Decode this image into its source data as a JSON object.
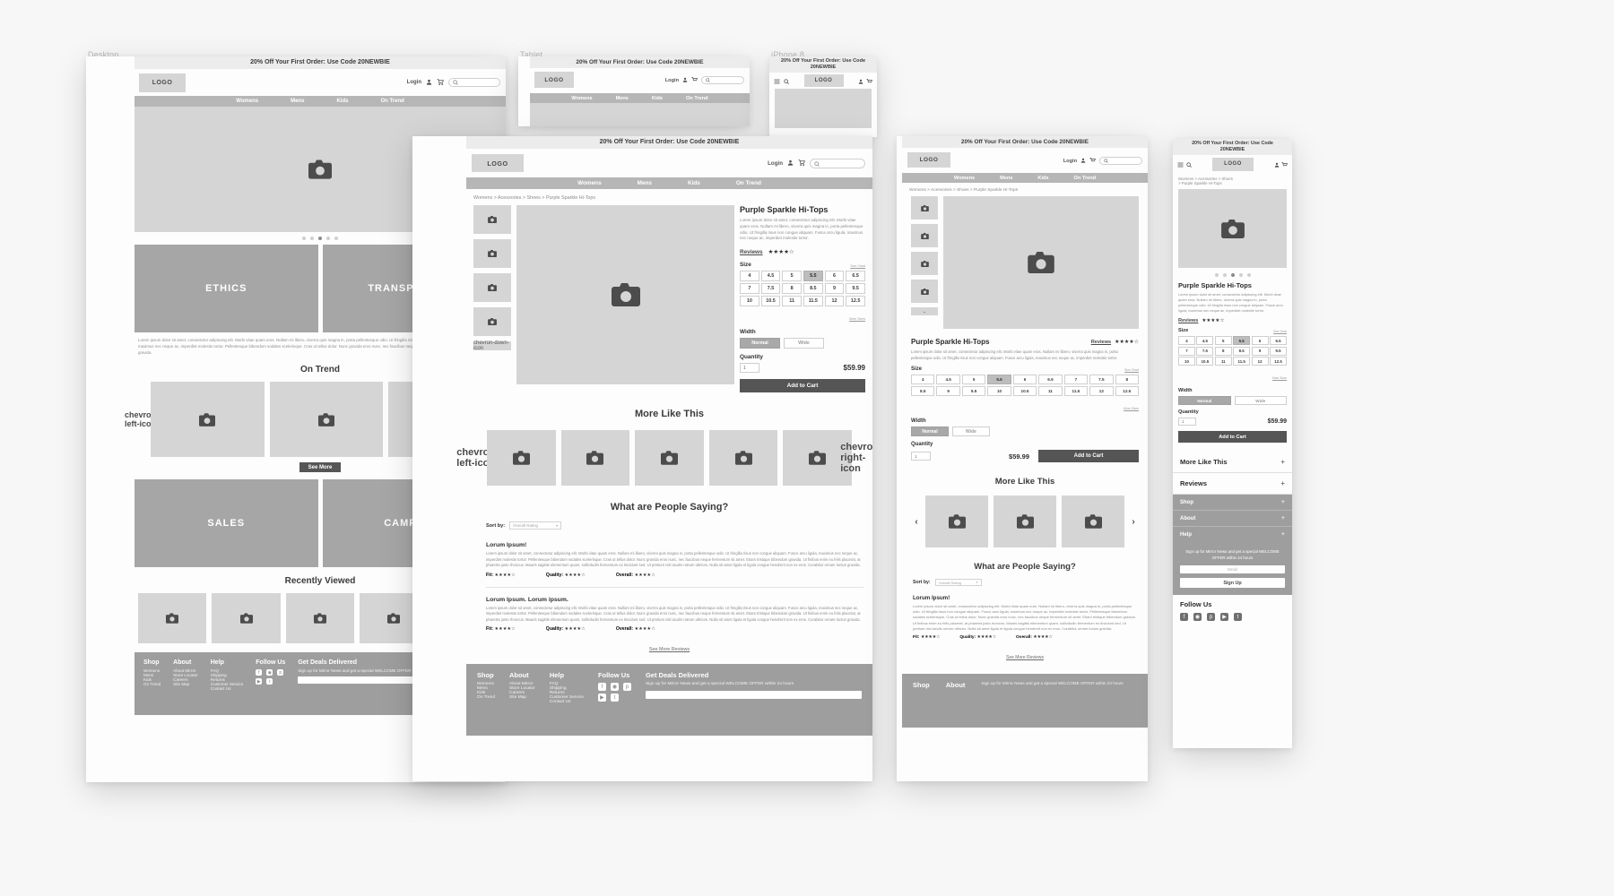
{
  "devices": {
    "desktop": "Desktop",
    "tablet": "Tablet",
    "iphone": "iPhone 8"
  },
  "promo": "20% Off Your First Order: Use Code 20NEWBIE",
  "logo": "LOGO",
  "nav": [
    "Womens",
    "Mens",
    "Kids",
    "On Trend"
  ],
  "util": {
    "login": "Login",
    "account_icon": "user-icon",
    "cart_icon": "cart-icon",
    "search_icon": "search-icon",
    "search_placeholder": ""
  },
  "breadcrumb": "Womens > Acessories > Shoes > Purple Sparkle Hi-Tops",
  "breadcrumb_mobile_1": "Womens > Acessories > Shoes",
  "breadcrumb_mobile_2": "> Purple Sparkle Hi-Tops",
  "product": {
    "title": "Purple Sparkle Hi-Tops",
    "description": "Lorem ipsum dolor sit amet, consectetur adipiscing elit. Morbi vitae quam eros. Nullam mi libero, viverra quis magna in, porta pellentesque odio. Ut fringilla risus non congue aliquam. Fusce arcu ligula, maximus nec neque ac, imperdiet molestie tortor.",
    "reviews_label": "Reviews",
    "rating": "★★★★☆",
    "size_label": "Size",
    "size_chart": "Size Chart",
    "more_sizes": "More Sizes",
    "sizes": [
      "4",
      "4.5",
      "5",
      "5.5",
      "6",
      "6.5",
      "7",
      "7.5",
      "8",
      "8.5",
      "9",
      "9.5",
      "10",
      "10.5",
      "11",
      "11.5",
      "12",
      "12.5"
    ],
    "selected_size": "5.5",
    "width_label": "Width",
    "widths": [
      "Normal",
      "Wide"
    ],
    "selected_width": "Normal",
    "quantity_label": "Quantity",
    "quantity": "1",
    "price": "$59.99",
    "add_to_cart": "Add to Cart"
  },
  "sections": {
    "more_like_this": "More Like This",
    "what_people_saying": "What are People Saying?",
    "on_trend": "On Trend",
    "recently_viewed": "Recently Viewed",
    "see_more": "See More",
    "see_more_reviews": "See More Reviews",
    "reviews": "Reviews"
  },
  "hero_bands": [
    "ETHICS",
    "TRANSPARENCY",
    "SALES",
    "CAMPAIGN"
  ],
  "hero_paragraph": "Lorem ipsum dolor sit amet, consectetur adipiscing elit. Morbi vitae quam eros. Nullam mi libero, viverra quis magna in, porta pellentesque odio. Ut fringilla risus non congue aliquam. Fusce arcu ligula, maximus nec neque ac, imperdiet molestie tortor. Pellentesque bibendum sodales scelerisque. Cras ut tellus dolor. Nunc gravida eros nunc, nec faucibus neque fermentum sit amet. Etiam tristique bibendum gravida.",
  "sort": {
    "label": "Sort by:",
    "value": "Overall Rating",
    "caret": "chevron-down-icon"
  },
  "reviews_list": [
    {
      "title": "Lorum Ipsum!",
      "body": "Lorem ipsum dolor sit amet, consectetur adipiscing elit. Morbi vitae quam eros. Nullam mi libero, viverra quis magna in, porta pellentesque odio. Ut fringilla risus non congue aliquam. Fusce arcu ligula, maximus nec neque ac, imperdiet molestie tortor. Pellentesque bibendum sodales scelerisque. Cras ut tellus dolor. Nunc gravida eros nunc, nec faucibus neque fermentum sit amet. Etiam tristique bibendum gravida. Ut finibus enim eu felis placerat, at pharetra justo rhoncus. Mauris sagittis elementum quam, sollicitudin fermentum ex tincidunt sed. Ut pretium nisl iaculis rutrum ultrices. Nulla sit amet ligula et ligula congue hendrerit non ex eros. Curabitur ornare luctus gravida.",
      "fit_label": "Fit:",
      "fit": "★★★★☆",
      "quality_label": "Quality:",
      "quality": "★★★★☆",
      "overall_label": "Overall:",
      "overall": "★★★★☆"
    },
    {
      "title": "Lorum Ipsum. Lorum ipsum.",
      "body": "Lorem ipsum dolor sit amet, consectetur adipiscing elit. Morbi vitae quam eros. Nullam mi libero, viverra quis magna in, porta pellentesque odio. Ut fringilla risus non congue aliquam. Fusce arcu ligula, maximus nec neque ac, imperdiet molestie tortor. Pellentesque bibendum sodales scelerisque. Cras ut tellus dolor. Nunc gravida eros nunc, nec faucibus neque fermentum sit amet. Etiam tristique bibendum gravida. Ut finibus enim eu felis placerat, at pharetra justo rhoncus. Mauris sagittis elementum quam, sollicitudin fermentum ex tincidunt sed. Ut pretium nisl iaculis rutrum ultrices. Nulla sit amet ligula et ligula congue hendrerit non ex eros. Curabitur ornare luctus gravida.",
      "fit_label": "Fit:",
      "fit": "★★★★☆",
      "quality_label": "Quality:",
      "quality": "★★★★☆",
      "overall_label": "Overall:",
      "overall": "★★★★☆"
    }
  ],
  "footer": {
    "cols": [
      {
        "head": "Shop",
        "items": [
          "Womens",
          "Mens",
          "Kids",
          "On Trend"
        ]
      },
      {
        "head": "About",
        "items": [
          "About Mirror",
          "Store Locator",
          "Careers",
          "Site Map"
        ]
      },
      {
        "head": "Help",
        "items": [
          "FAQ",
          "Shipping",
          "Returns",
          "Customer Service",
          "Contact Us"
        ]
      }
    ],
    "follow_head": "Follow Us",
    "social": [
      "facebook-icon",
      "instagram-icon",
      "pinterest-icon",
      "youtube-icon",
      "twitter-icon"
    ],
    "deals_head": "Get Deals Delivered",
    "deals_copy": "Sign up for Mirror News and get a special WELCOME OFFER within 24 hours",
    "email_placeholder": "Email",
    "signup": "Sign Up"
  },
  "mobile_accordion": [
    {
      "label": "More Like This",
      "sign": "+"
    },
    {
      "label": "Reviews",
      "sign": "+"
    },
    {
      "label": "Shop",
      "sign": "+"
    },
    {
      "label": "About",
      "sign": "+"
    },
    {
      "label": "Help",
      "sign": "+"
    }
  ],
  "mobile_signup": {
    "copy": "Sign up for Mirror News and get a special WELCOME OFFER within 24 hours",
    "email_placeholder": "Email",
    "button": "Sign Up",
    "follow": "Follow Us"
  },
  "icons": {
    "camera": "camera-icon",
    "hamburger": "hamburger-icon",
    "prev": "chevron-left-icon",
    "next": "chevron-right-icon",
    "caret_down": "chevron-down-icon"
  },
  "colors": {
    "bg": "#f7f7f7",
    "placeholder": "#d5d5d5",
    "nav": "#b6b6b6",
    "band": "#a6a6a6",
    "dark": "#555555",
    "footer": "#9e9e9e"
  }
}
